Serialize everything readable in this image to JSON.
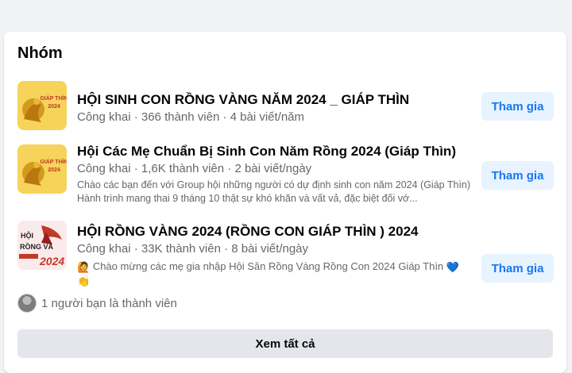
{
  "section": {
    "title": "Nhóm"
  },
  "groups": [
    {
      "name": "HỘI SINH CON RỒNG VÀNG NĂM 2024 _ GIÁP THÌN",
      "meta": "Công khai · 366 thành viên · 4 bài viết/năm",
      "thumb_text": [
        "GIÁP THÌN",
        "2024"
      ],
      "join_label": "Tham gia"
    },
    {
      "name": "Hội Các Mẹ Chuẩn Bị Sinh Con Năm Rồng 2024 (Giáp Thìn)",
      "meta": "Công khai · 1,6K thành viên · 2 bài viết/ngày",
      "description": "Chào các bạn đến với Group hội những người có dự định sinh con năm 2024 (Giáp Thìn) Hành trình mang thai 9 tháng 10 thật sự khó khăn và vất vả, đặc biệt đối vớ...",
      "thumb_text": [
        "GIÁP THÌN",
        "2024"
      ],
      "join_label": "Tham gia"
    },
    {
      "name": "HỘI RỒNG VÀNG 2024 (RỒNG CON GIÁP THÌN ) 2024",
      "meta": "Công khai · 33K thành viên · 8 bài viết/ngày",
      "description": "Chào mừng các mẹ gia nhập Hội Săn Rồng Vàng Rồng Con 2024 Giáp Thìn",
      "thumb_text": [
        "HỘI",
        "RỒNG VÀ",
        "2024"
      ],
      "join_label": "Tham gia"
    }
  ],
  "friends": {
    "text": "1 người bạn là thành viên"
  },
  "footer": {
    "see_all_label": "Xem tất cả"
  },
  "colors": {
    "accent": "#1877f2",
    "join_bg": "#e7f3ff",
    "muted": "#65676b"
  }
}
